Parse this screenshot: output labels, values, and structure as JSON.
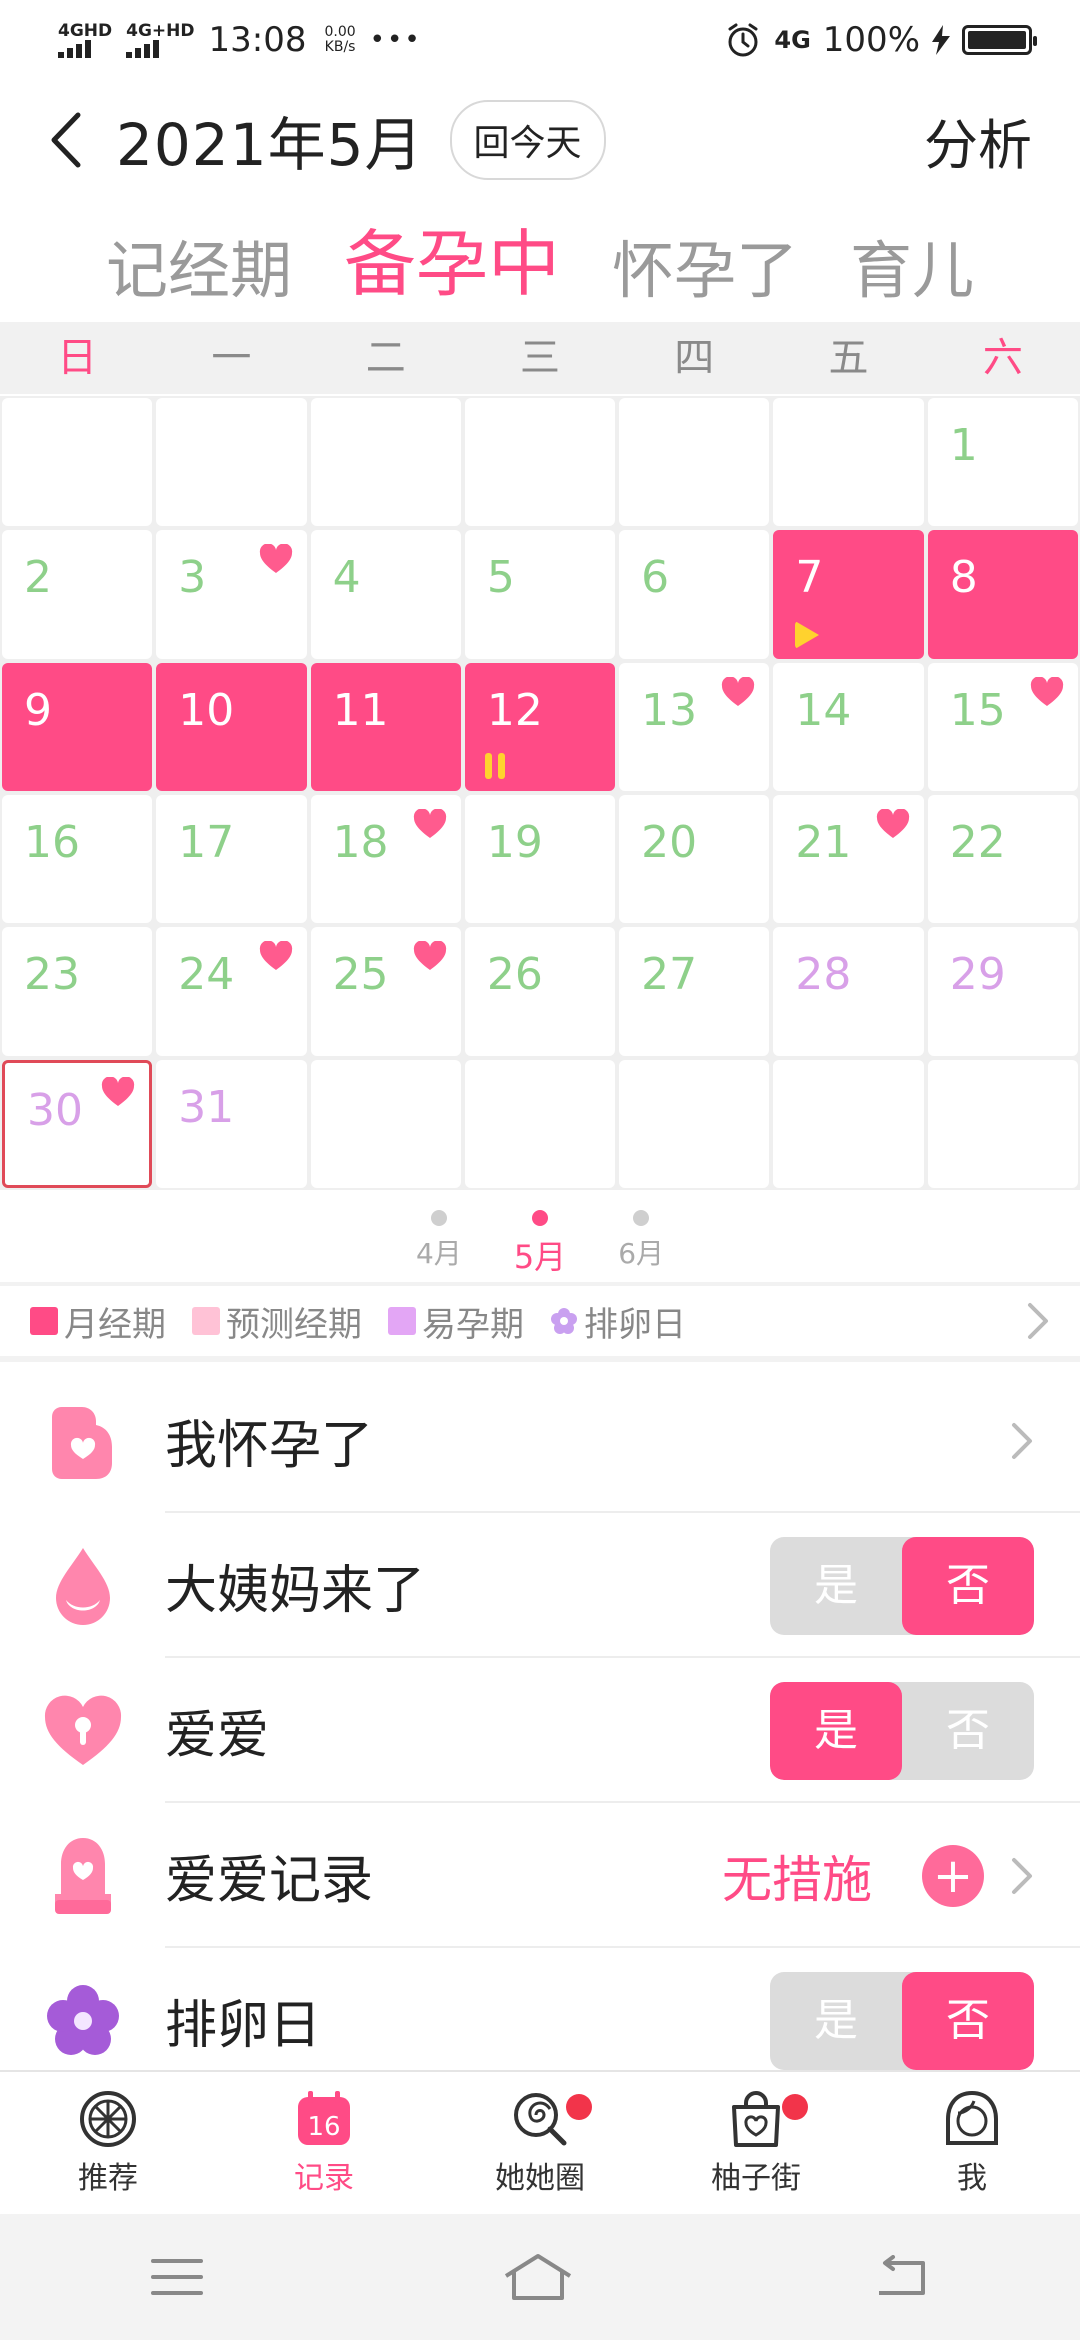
{
  "status_bar": {
    "signal1": "4GHD",
    "signal2": "4G+HD",
    "time": "13:08",
    "net_speed": "0.00",
    "net_unit": "KB/s",
    "dots": "•••",
    "net_type": "4G",
    "battery": "100%"
  },
  "header": {
    "title": "2021年5月",
    "today_label": "回今天",
    "analyze_label": "分析"
  },
  "modes": [
    {
      "label": "记经期",
      "active": false
    },
    {
      "label": "备孕中",
      "active": true
    },
    {
      "label": "怀孕了",
      "active": false
    },
    {
      "label": "育儿",
      "active": false
    }
  ],
  "weekdays": [
    "日",
    "一",
    "二",
    "三",
    "四",
    "五",
    "六"
  ],
  "calendar": {
    "leading_blanks": 6,
    "trailing_blanks": 5,
    "days": [
      {
        "d": "1"
      },
      {
        "d": "2"
      },
      {
        "d": "3",
        "heart": true
      },
      {
        "d": "4"
      },
      {
        "d": "5"
      },
      {
        "d": "6"
      },
      {
        "d": "7",
        "period": true,
        "marker": "start"
      },
      {
        "d": "8",
        "period": true
      },
      {
        "d": "9",
        "period": true
      },
      {
        "d": "10",
        "period": true
      },
      {
        "d": "11",
        "period": true
      },
      {
        "d": "12",
        "period": true,
        "marker": "end"
      },
      {
        "d": "13",
        "heart": true
      },
      {
        "d": "14"
      },
      {
        "d": "15",
        "heart": true
      },
      {
        "d": "16"
      },
      {
        "d": "17"
      },
      {
        "d": "18",
        "heart": true
      },
      {
        "d": "19"
      },
      {
        "d": "20"
      },
      {
        "d": "21",
        "heart": true
      },
      {
        "d": "22"
      },
      {
        "d": "23"
      },
      {
        "d": "24",
        "heart": true
      },
      {
        "d": "25",
        "heart": true
      },
      {
        "d": "26"
      },
      {
        "d": "27"
      },
      {
        "d": "28",
        "fertile": true
      },
      {
        "d": "29",
        "fertile": true
      },
      {
        "d": "30",
        "fertile": true,
        "heart": true,
        "today": true
      },
      {
        "d": "31",
        "fertile": true
      }
    ]
  },
  "month_nav": [
    {
      "label": "4月",
      "active": false
    },
    {
      "label": "5月",
      "active": true
    },
    {
      "label": "6月",
      "active": false
    }
  ],
  "legend": [
    {
      "label": "月经期",
      "color": "#ff4b86",
      "shape": "square"
    },
    {
      "label": "预测经期",
      "color": "#ffc2d6",
      "shape": "square"
    },
    {
      "label": "易孕期",
      "color": "#e3a6f5",
      "shape": "square"
    },
    {
      "label": "排卵日",
      "color": "#c9a0f0",
      "shape": "flower"
    }
  ],
  "rows": [
    {
      "label": "我怀孕了",
      "icon": "pregnant-icon",
      "type": "arrow"
    },
    {
      "label": "大姨妈来了",
      "icon": "drop-icon",
      "type": "toggle",
      "yes": "是",
      "no": "否",
      "value": "no"
    },
    {
      "label": "爱爱",
      "icon": "heart-lock-icon",
      "type": "toggle",
      "yes": "是",
      "no": "否",
      "value": "yes"
    },
    {
      "label": "爱爱记录",
      "icon": "bell-heart-icon",
      "type": "value",
      "value": "无措施"
    },
    {
      "label": "排卵日",
      "icon": "flower-icon",
      "type": "toggle",
      "yes": "是",
      "no": "否",
      "value": "no"
    }
  ],
  "bottom_nav": [
    {
      "label": "推荐",
      "icon": "grapefruit-icon",
      "active": false
    },
    {
      "label": "记录",
      "icon": "calendar-icon",
      "badge": "16",
      "active": true
    },
    {
      "label": "她她圈",
      "icon": "lollipop-icon",
      "active": false,
      "dot": true
    },
    {
      "label": "柚子街",
      "icon": "shopping-bag-icon",
      "active": false,
      "dot": true
    },
    {
      "label": "我",
      "icon": "profile-icon",
      "active": false
    }
  ]
}
